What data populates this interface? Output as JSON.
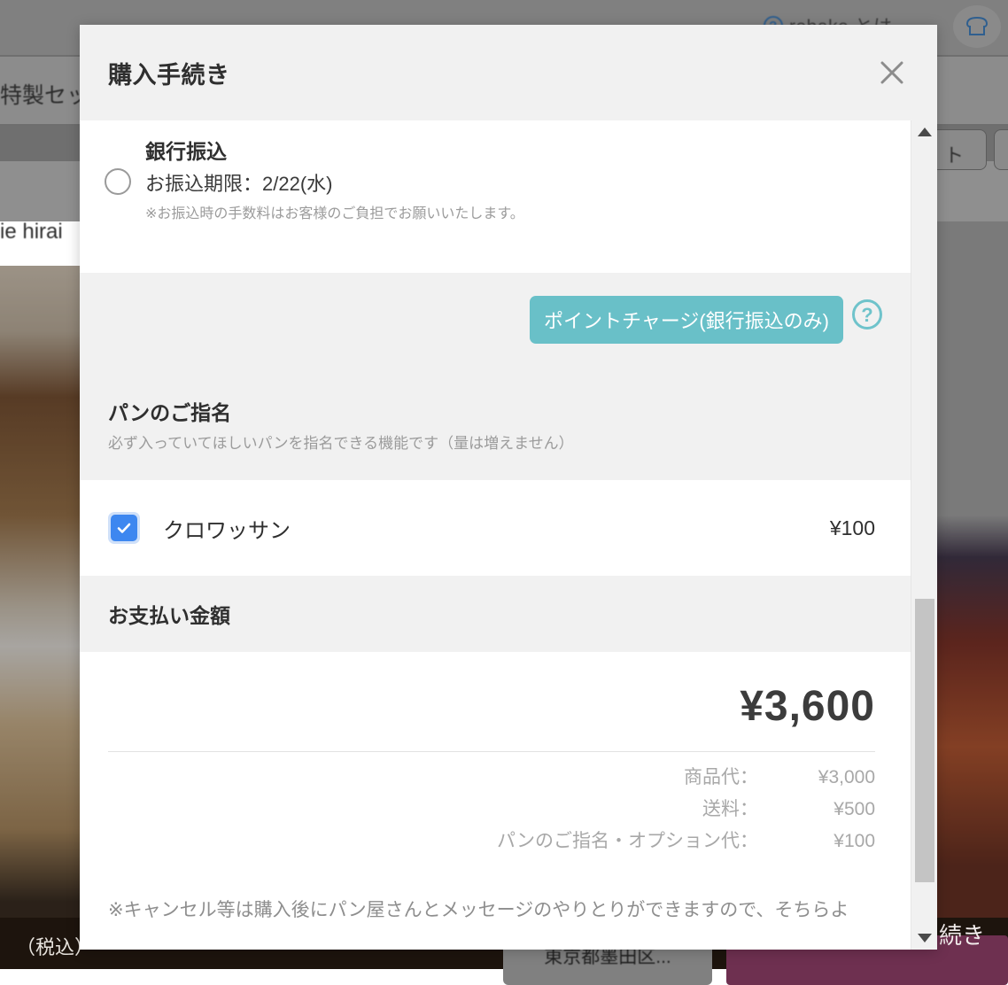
{
  "background": {
    "help_link": "rebake とは",
    "bread_icon": "bread-icon",
    "product_text": "特製セッ",
    "chip_text": "ト",
    "baker_name": "ie hirai",
    "tax_label": "（税込）",
    "address_button": "東京都墨田区...",
    "continue_button": "続き"
  },
  "modal": {
    "title": "購入手続き",
    "close_icon": "close-icon",
    "payment": {
      "method_title": "銀行振込",
      "deadline": "お振込期限：2/22(水)",
      "note": "※お振込時の手数料はお客様のご負担でお願いいたします。",
      "radio_selected": false
    },
    "charge": {
      "button_label": "ポイントチャージ(銀行振込のみ)",
      "help_icon": "question-circle-icon",
      "accent_color": "#69c0c8"
    },
    "nomination": {
      "title": "パンのご指名",
      "subtitle": "必ず入っていてほしいパンを指名できる機能です（量は増えません）",
      "items": [
        {
          "name": "クロワッサン",
          "price": "¥100",
          "checked": true
        }
      ]
    },
    "amount": {
      "section_title": "お支払い金額",
      "total": "¥3,600",
      "breakdown": [
        {
          "label": "商品代：",
          "value": "¥3,000"
        },
        {
          "label": "送料：",
          "value": "¥500"
        },
        {
          "label": "パンのご指名・オプション代：",
          "value": "¥100"
        }
      ]
    },
    "footer_note": "※キャンセル等は購入後にパン屋さんとメッセージのやりとりができますので、そちらよ",
    "scrollbar": {
      "up_arrow": "caret-up-icon",
      "down_arrow": "caret-down-icon"
    }
  }
}
